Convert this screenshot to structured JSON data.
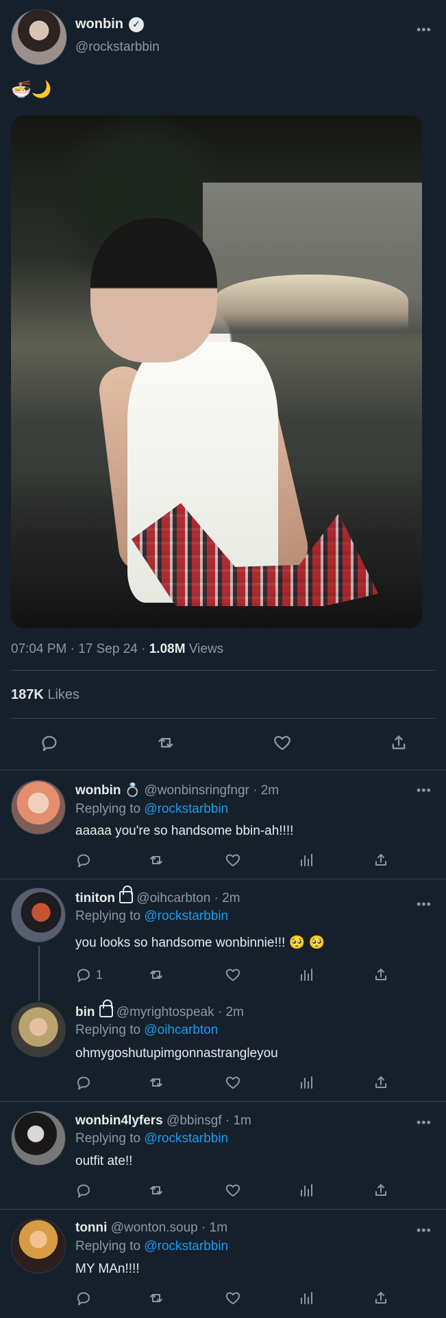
{
  "main_tweet": {
    "display_name": "wonbin",
    "verified_mark": "✓",
    "handle": "@rockstarbbin",
    "text": "🍜🌙",
    "more": "•••",
    "timestamp": "07:04 PM · 17 Sep 24 · ",
    "views_count": "1.08M",
    "views_label": " Views",
    "likes_count": "187K",
    "likes_label": " Likes",
    "icons": [
      "reply-icon",
      "retweet-icon",
      "like-icon",
      "share-icon"
    ]
  },
  "replies": [
    {
      "display_name": "wonbin",
      "badge": "💍",
      "handle": "@wonbinsringfngr · 2m",
      "replying_prefix": "Replying to ",
      "replying_to": "@rockstarbbin",
      "text": "aaaaa you're so handsome bbin-ah!!!!",
      "reply_count": "",
      "more": "•••"
    },
    {
      "display_name": "tiniton",
      "badge": "lock",
      "handle": "@oihcarbton · 2m",
      "replying_prefix": "Replying to ",
      "replying_to": "@rockstarbbin",
      "text": "you looks so handsome wonbinnie!!! 🥺 🥺",
      "reply_count": "1",
      "more": "•••"
    },
    {
      "display_name": "bin",
      "badge": "lock",
      "handle": "@myrightospeak · 2m",
      "replying_prefix": "Replying to ",
      "replying_to": "@oihcarbton",
      "text": "ohmygoshutupimgonnastrangleyou",
      "reply_count": "",
      "more": "•••"
    },
    {
      "display_name": "wonbin4lyfers",
      "badge": "",
      "handle": "@bbinsgf · 1m",
      "replying_prefix": "Replying to ",
      "replying_to": "@rockstarbbin",
      "text": "outfit ate!!",
      "reply_count": "",
      "more": "•••"
    },
    {
      "display_name": "tonni",
      "badge": "",
      "handle": "@wonton.soup · 1m",
      "replying_prefix": "Replying to ",
      "replying_to": "@rockstarbbin",
      "text": "MY MAn!!!!",
      "reply_count": "",
      "more": "•••"
    }
  ],
  "theme": {
    "background": "#15202b",
    "text": "#e7e9ea",
    "muted": "#8b98a5",
    "link": "#1d9bf0",
    "divider": "#38444d"
  }
}
